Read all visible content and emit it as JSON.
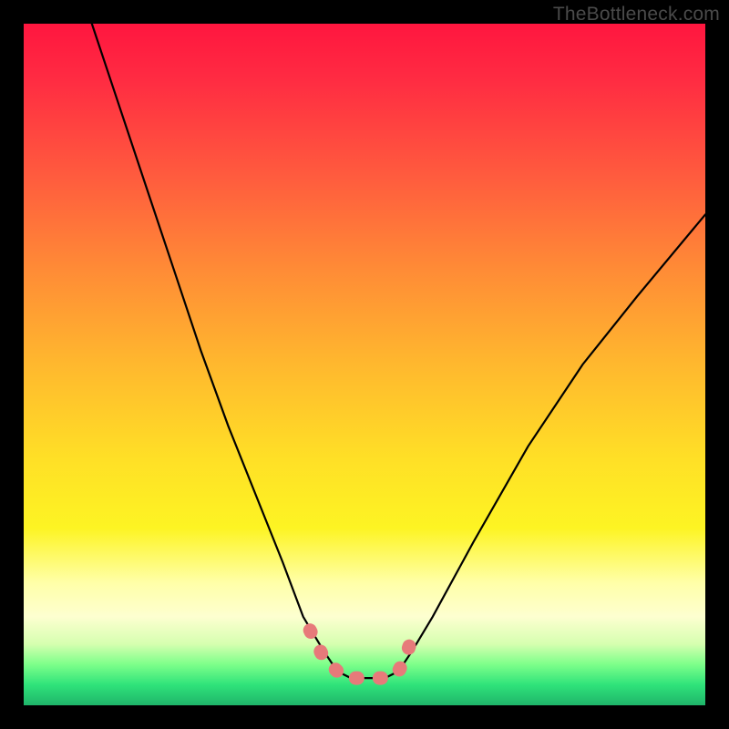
{
  "watermark": "TheBottleneck.com",
  "chart_data": {
    "type": "line",
    "title": "",
    "xlabel": "",
    "ylabel": "",
    "xlim": [
      0,
      100
    ],
    "ylim": [
      0,
      100
    ],
    "series": [
      {
        "name": "black-curve",
        "x": [
          10,
          14,
          18,
          22,
          26,
          30,
          34,
          38,
          41,
          44,
          46,
          48,
          53,
          55,
          57,
          60,
          66,
          74,
          82,
          90,
          100
        ],
        "values": [
          100,
          88,
          76,
          64,
          52,
          41,
          31,
          21,
          13,
          8,
          5,
          4,
          4,
          5,
          8,
          13,
          24,
          38,
          50,
          60,
          72
        ]
      },
      {
        "name": "pink-overlay",
        "x": [
          42,
          44,
          46,
          47,
          48,
          50,
          52,
          54,
          55,
          56,
          57
        ],
        "values": [
          11,
          7,
          5,
          4,
          4,
          4,
          4,
          4,
          5,
          7,
          10
        ]
      }
    ],
    "colors": {
      "black_curve": "#000000",
      "pink_overlay": "#e77a7a",
      "gradient_top": "#ff163f",
      "gradient_bottom": "#1fb46a",
      "frame": "#000000"
    }
  }
}
